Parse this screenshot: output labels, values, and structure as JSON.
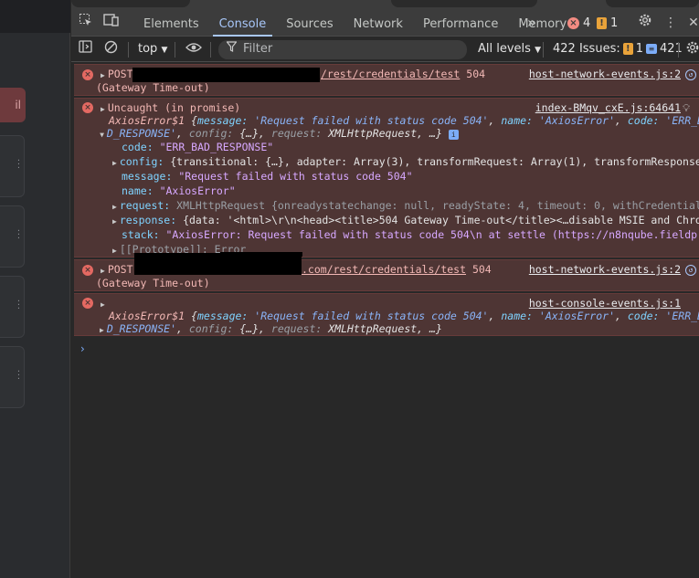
{
  "page": {
    "button_label": "il"
  },
  "devtools": {
    "tabs": [
      {
        "label": "Elements"
      },
      {
        "label": "Console"
      },
      {
        "label": "Sources"
      },
      {
        "label": "Network"
      },
      {
        "label": "Performance"
      },
      {
        "label": "Memory"
      }
    ],
    "more_tabs": "»",
    "error_count": "4",
    "warning_count": "1",
    "toolbar": {
      "context": "top",
      "filter_placeholder": "Filter",
      "levels": "All levels",
      "issues_label": "422 Issues:",
      "issues_warn": "1",
      "issues_info": "421"
    }
  },
  "console": {
    "m1": {
      "prefix": "POST",
      "url_tail": "/rest/credentials/test",
      "status": "504",
      "text2": "(Gateway Time-out)",
      "source": "host-network-events.js:2"
    },
    "m2": {
      "head": "Uncaught (in promise)",
      "source": "index-BMqv_cxE.js:64641",
      "l2_name": "AxiosError$1",
      "l2_msg_key": "message:",
      "l2_msg_val": "'Request failed with status code 504'",
      "l2_name_key": "name:",
      "l2_name_val": "'AxiosError'",
      "l2_code_key": "code:",
      "l2_code_val": "'ERR_BA",
      "l3_code_cont": "D_RESPONSE'",
      "l3_config_key": "config:",
      "l3_config_val": "{…}",
      "l3_req_key": "request:",
      "l3_req_val": "XMLHttpRequest",
      "l3_tail": "…}",
      "code_key": "code:",
      "code_val": "\"ERR_BAD_RESPONSE\"",
      "config_key": "config:",
      "config_val": "{transitional: {…}, adapter: Array(3), transformRequest: Array(1), transformResponse:",
      "message_key": "message:",
      "message_val": "\"Request failed with status code 504\"",
      "name_key": "name:",
      "name_val": "\"AxiosError\"",
      "request_key": "request:",
      "request_val": "XMLHttpRequest {onreadystatechange: null, readyState: 4, timeout: 0, withCredentials:",
      "response_key": "response:",
      "response_val": "{data: '<html>\\r\\n<head><title>504 Gateway Time-out</title><…disable MSIE and Chrome",
      "stack_key": "stack:",
      "stack_val": "\"AxiosError: Request failed with status code 504\\n    at settle (https://n8nqube.fieldp",
      "proto": "[[Prototype]]: Error"
    },
    "m3": {
      "prefix": "POST",
      "url_tail": ".com/rest/credentials/test",
      "status": "504",
      "text2": "(Gateway Time-out)",
      "source": "host-network-events.js:2"
    },
    "m4": {
      "source": "host-console-events.js:1",
      "l2_name": "AxiosError$1",
      "l2_msg_key": "message:",
      "l2_msg_val": "'Request failed with status code 504'",
      "l2_name_key": "name:",
      "l2_name_val": "'AxiosError'",
      "l2_code_key": "code:",
      "l2_code_val": "'ERR_BA",
      "l3_code_cont": "D_RESPONSE'",
      "l3_config_key": "config:",
      "l3_config_val": "{…}",
      "l3_req_key": "request:",
      "l3_req_val": "XMLHttpRequest",
      "l3_tail": "…}"
    },
    "prompt": "›"
  },
  "colors": {
    "error_bg": "#4e3534",
    "error_text": "#f2b8b5",
    "accent": "#a8c7fa",
    "toolbar_bg": "#3c3c3c"
  }
}
